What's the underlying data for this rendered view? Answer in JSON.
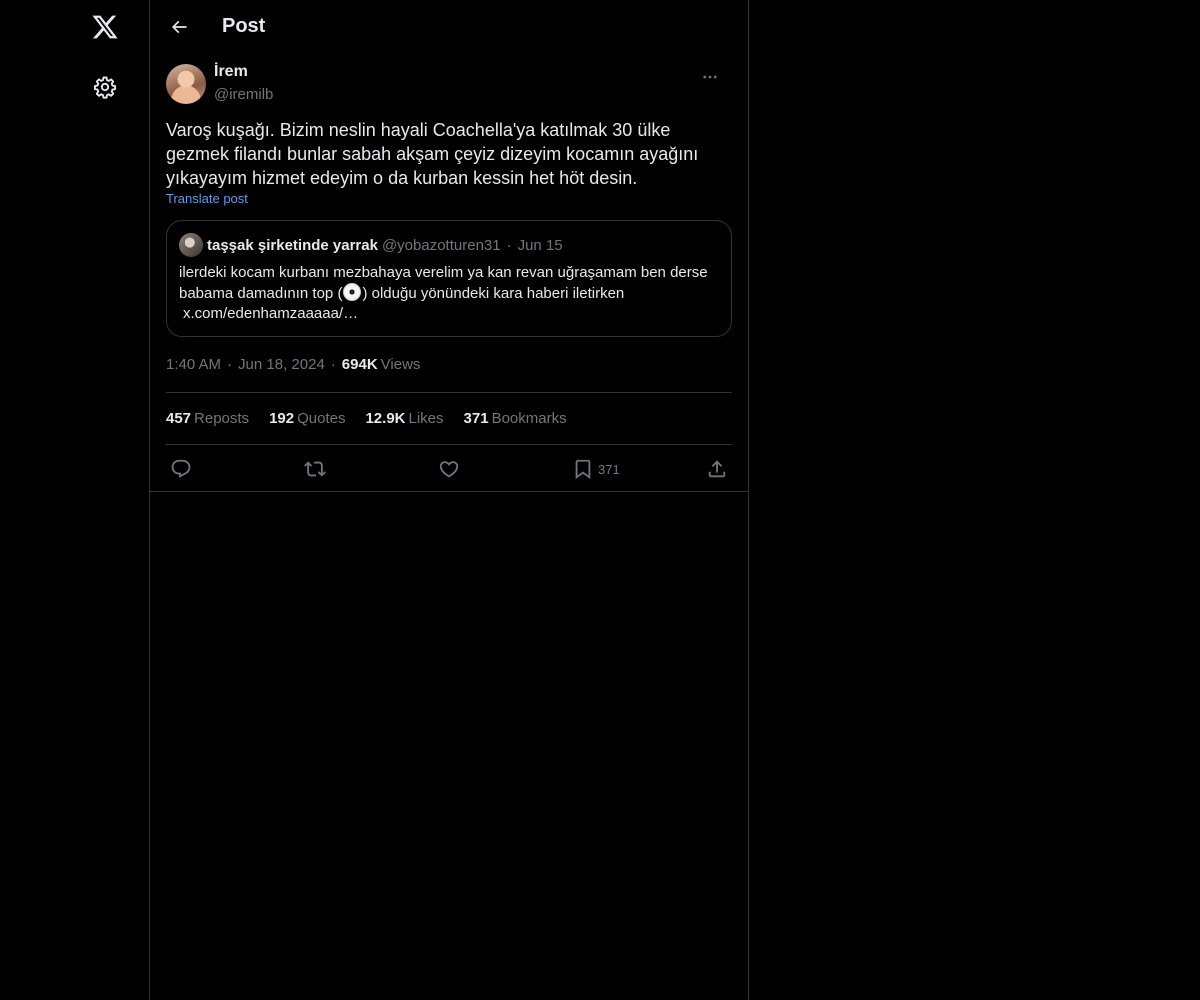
{
  "nav": {
    "logo_icon": "x-logo-icon",
    "settings_icon": "gear-icon"
  },
  "header": {
    "title": "Post"
  },
  "post": {
    "author_name": "İrem",
    "author_handle": "@iremilb",
    "text": "Varoş kuşağı. Bizim neslin hayali Coachella'ya katılmak 30 ülke gezmek filandı bunlar sabah akşam çeyiz dizeyim kocamın ayağını yıkayayım hizmet edeyim o da kurban kessin het höt desin.",
    "translate_label": "Translate post",
    "quote": {
      "name": "taşşak şirketinde yarrak",
      "handle": "@yobazotturen31",
      "date": "Jun 15",
      "text_before": "ilerdeki kocam kurbanı mezbahaya verelim ya kan revan uğraşamam ben derse babama damadının top (",
      "text_after": ") olduğu yönündeki kara haberi iletirken",
      "link": "x.com/edenhamzaaaaa/…"
    },
    "time": "1:40 AM",
    "date": "Jun 18, 2024",
    "views_count": "694K",
    "views_label": "Views",
    "stats": {
      "reposts_count": "457",
      "reposts_label": "Reposts",
      "quotes_count": "192",
      "quotes_label": "Quotes",
      "likes_count": "12.9K",
      "likes_label": "Likes",
      "bookmarks_count": "371",
      "bookmarks_label": "Bookmarks"
    },
    "actions": {
      "reply_icon": "reply-icon",
      "repost_icon": "repost-icon",
      "like_icon": "heart-icon",
      "bookmark_icon": "bookmark-icon",
      "bookmark_count": "371",
      "share_icon": "share-icon"
    }
  },
  "colors": {
    "background": "#000000",
    "text": "#e7e9ea",
    "muted": "#71767b",
    "border": "#2f3336",
    "link": "#5c9ded"
  }
}
